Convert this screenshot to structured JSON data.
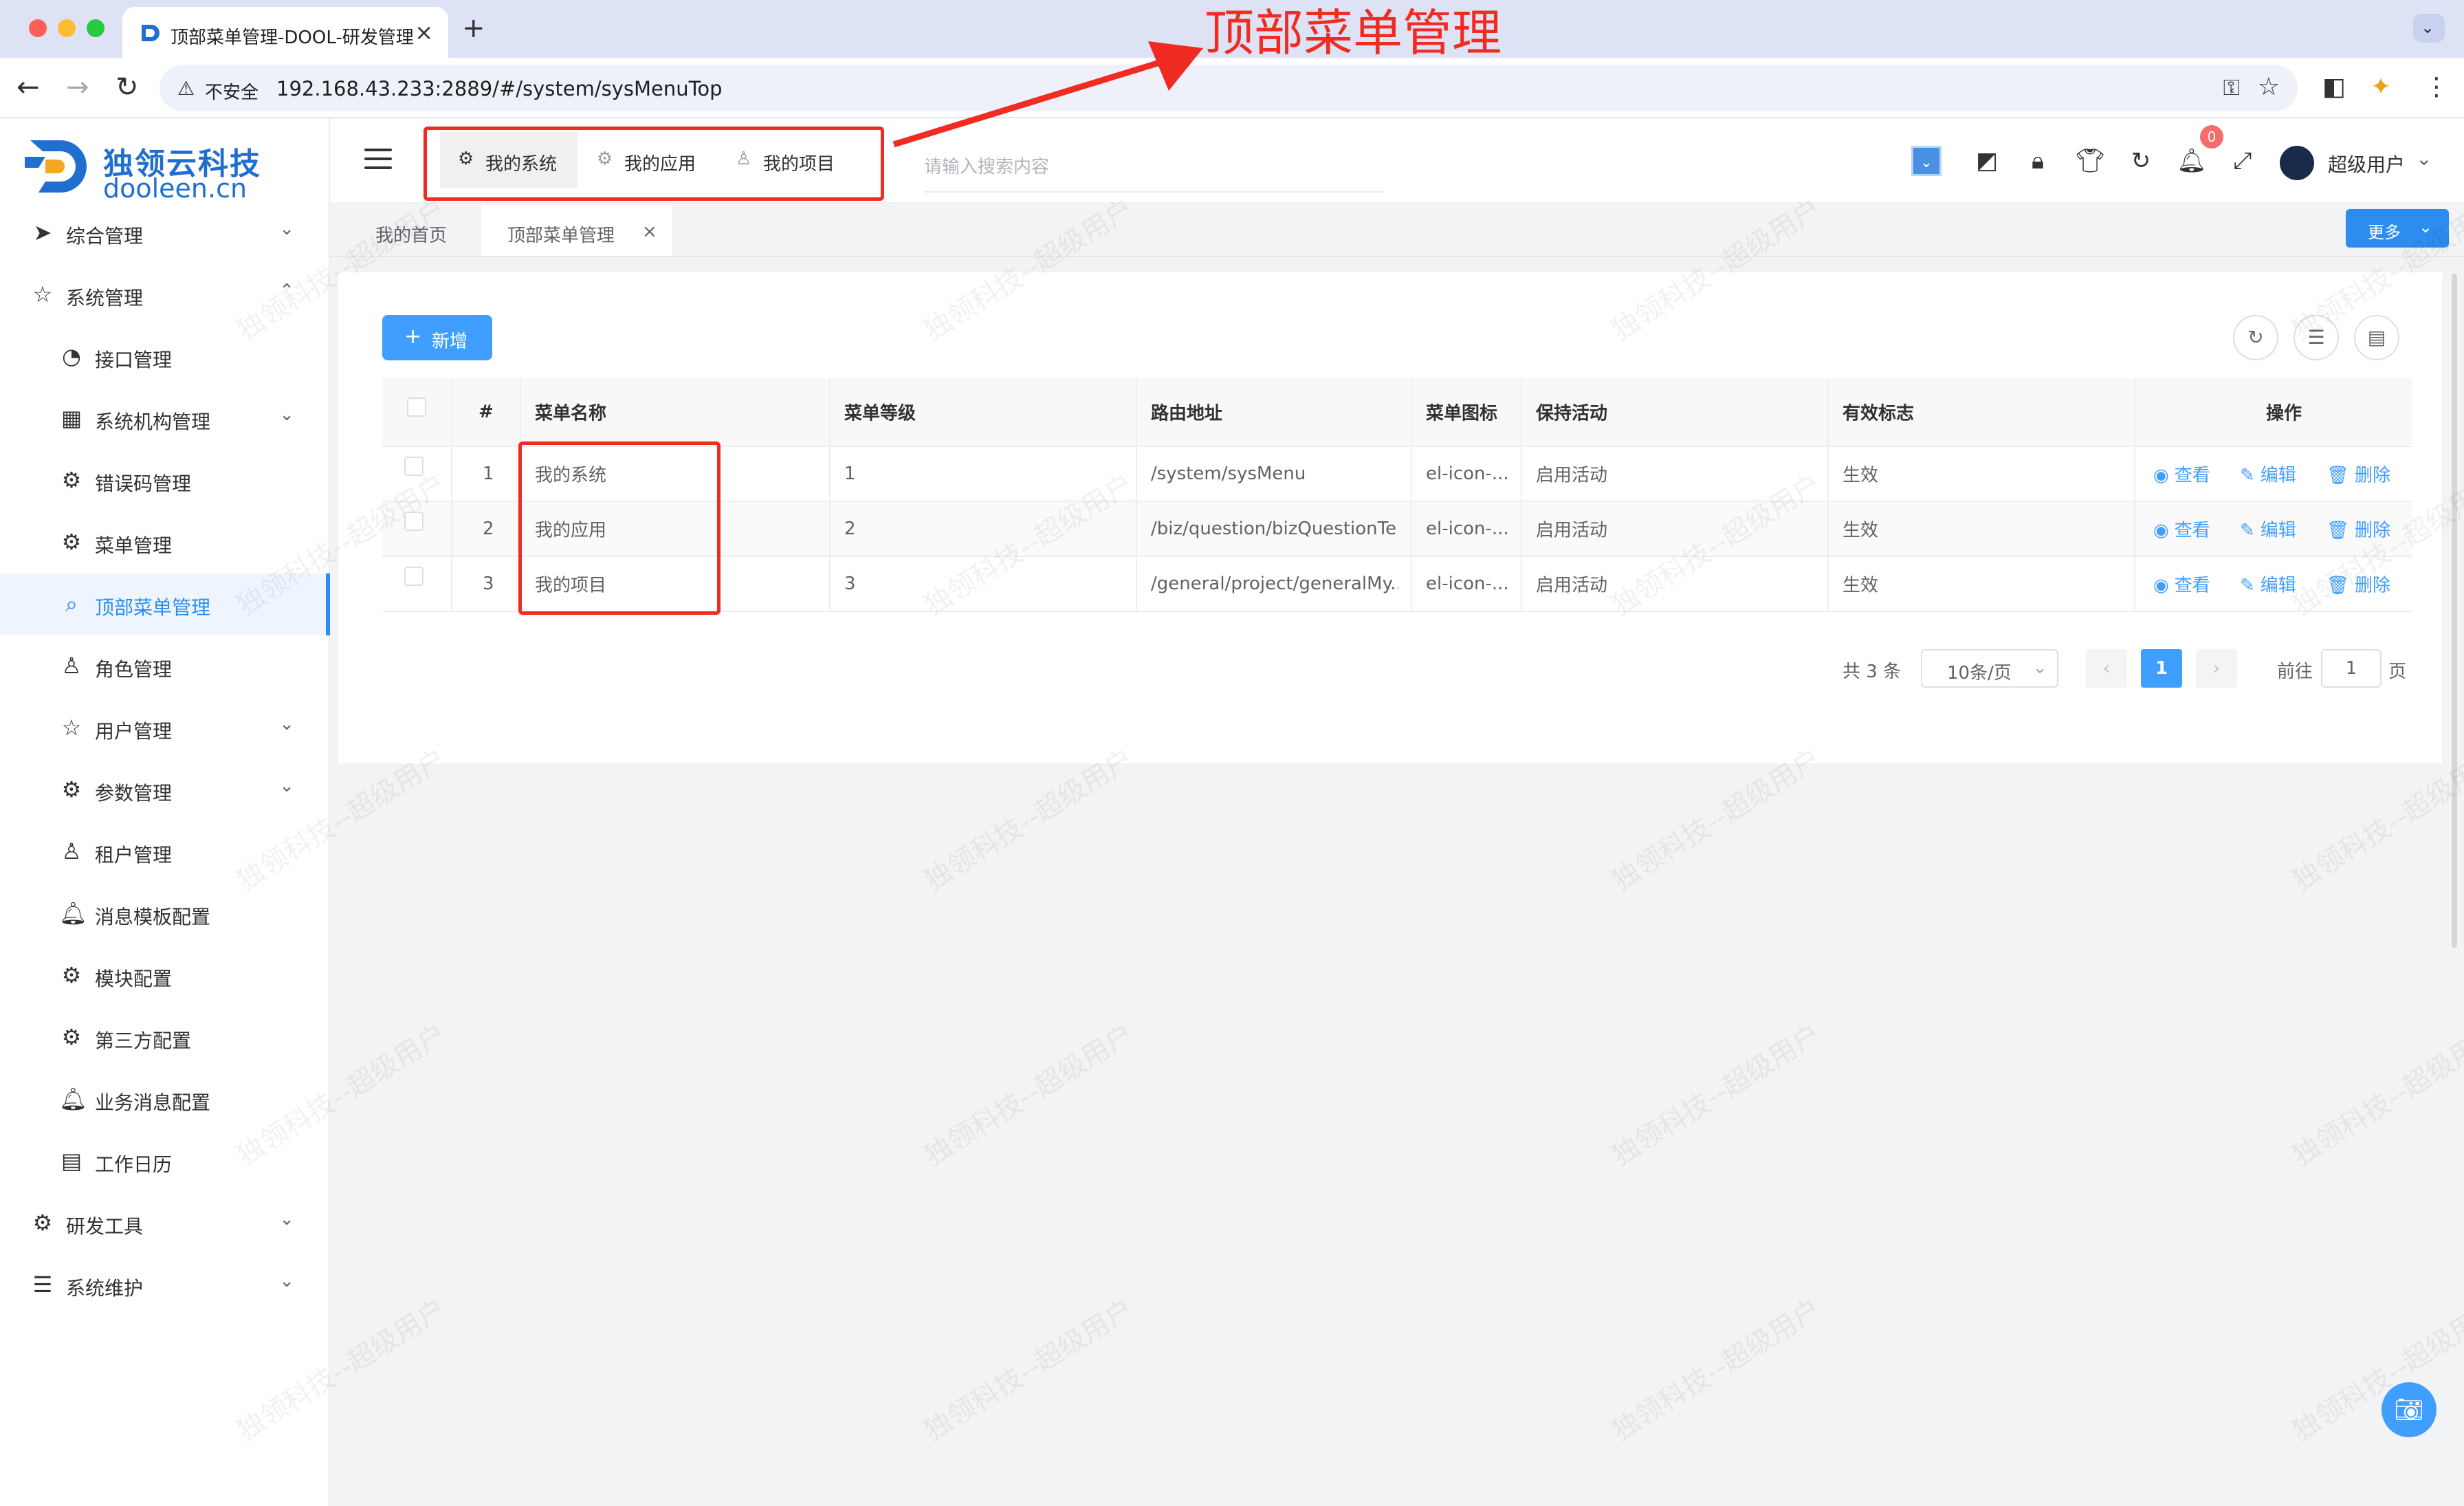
{
  "browser": {
    "tab_title": "顶部菜单管理-DOOL-研发管理",
    "security_label": "不安全",
    "url": "192.168.43.233:2889/#/system/sysMenuTop"
  },
  "logo": {
    "cn": "独领云科技",
    "en": "dooleen.cn"
  },
  "sidebar": {
    "items": [
      {
        "label": "综合管理",
        "icon": "send-icon"
      },
      {
        "label": "系统管理",
        "icon": "star-icon"
      },
      {
        "label": "接口管理",
        "icon": "gauge-icon"
      },
      {
        "label": "系统机构管理",
        "icon": "grid-icon"
      },
      {
        "label": "错误码管理",
        "icon": "gear-icon"
      },
      {
        "label": "菜单管理",
        "icon": "gear-icon"
      },
      {
        "label": "顶部菜单管理",
        "icon": "search-icon"
      },
      {
        "label": "角色管理",
        "icon": "user-icon"
      },
      {
        "label": "用户管理",
        "icon": "star-icon"
      },
      {
        "label": "参数管理",
        "icon": "gear-icon"
      },
      {
        "label": "租户管理",
        "icon": "user-icon"
      },
      {
        "label": "消息模板配置",
        "icon": "bell-icon"
      },
      {
        "label": "模块配置",
        "icon": "gear-icon"
      },
      {
        "label": "第三方配置",
        "icon": "gear-icon"
      },
      {
        "label": "业务消息配置",
        "icon": "bell-icon"
      },
      {
        "label": "工作日历",
        "icon": "calendar-icon"
      },
      {
        "label": "研发工具",
        "icon": "gear-icon"
      },
      {
        "label": "系统维护",
        "icon": "sliders-icon"
      }
    ]
  },
  "header": {
    "top_menus": [
      "我的系统",
      "我的应用",
      "我的项目"
    ],
    "search_placeholder": "请输入搜索内容",
    "notification_count": "0",
    "username": "超级用户"
  },
  "tags": {
    "home": "我的首页",
    "current": "顶部菜单管理",
    "more": "更多"
  },
  "toolbar": {
    "add_label": "新增"
  },
  "table": {
    "columns": [
      "#",
      "菜单名称",
      "菜单等级",
      "路由地址",
      "菜单图标",
      "保持活动",
      "有效标志",
      "操作"
    ],
    "rows": [
      {
        "index": "1",
        "name": "我的系统",
        "level": "1",
        "route": "/system/sysMenu",
        "icon": "el-icon-...",
        "keep_alive": "启用活动",
        "valid": "生效"
      },
      {
        "index": "2",
        "name": "我的应用",
        "level": "2",
        "route": "/biz/question/bizQuestionTe...",
        "icon": "el-icon-...",
        "keep_alive": "启用活动",
        "valid": "生效"
      },
      {
        "index": "3",
        "name": "我的项目",
        "level": "3",
        "route": "/general/project/generalMy...",
        "icon": "el-icon-...",
        "keep_alive": "启用活动",
        "valid": "生效"
      }
    ],
    "actions": {
      "view": "查看",
      "edit": "编辑",
      "delete": "删除"
    }
  },
  "pagination": {
    "total": "共 3 条",
    "page_size": "10条/页",
    "current": "1",
    "goto_label": "前往",
    "goto_value": "1",
    "page_suffix": "页"
  },
  "watermark": "独领科技--超级用户",
  "annotation": {
    "callout": "顶部菜单管理"
  },
  "colors": {
    "primary": "#409eff",
    "annotation": "#ef2b22",
    "sidebar_active": "#2d8cf0"
  }
}
